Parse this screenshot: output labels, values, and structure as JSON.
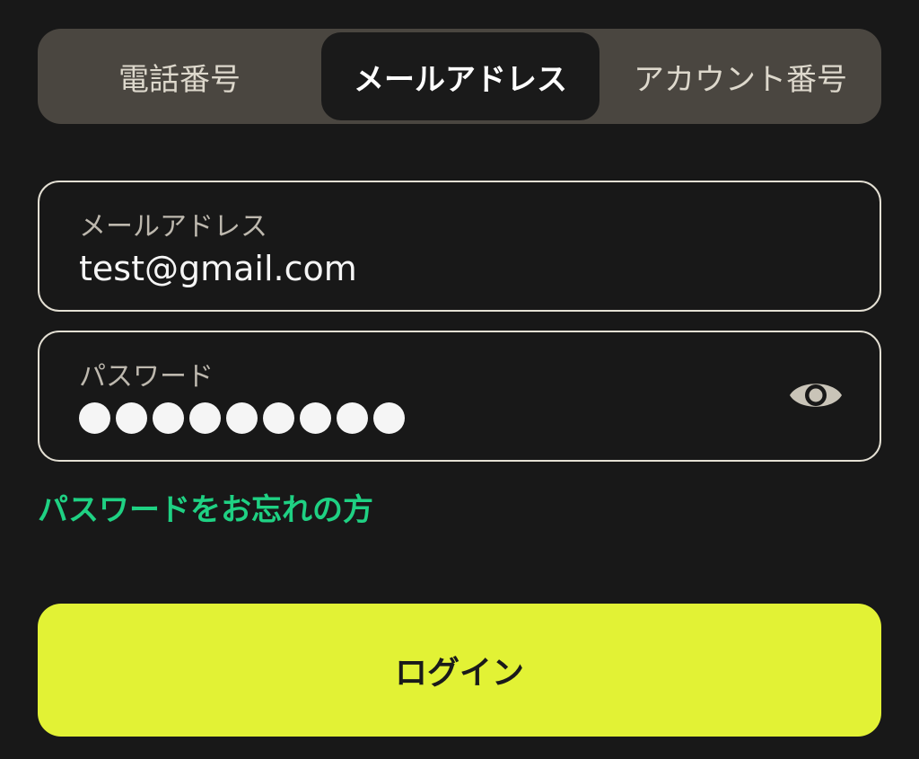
{
  "tabs": {
    "phone": "電話番号",
    "email": "メールアドレス",
    "account": "アカウント番号",
    "selected": "email"
  },
  "email_field": {
    "label": "メールアドレス",
    "value": "test@gmail.com"
  },
  "password_field": {
    "label": "パスワード",
    "masked_length": 9,
    "toggle_icon": "eye-icon"
  },
  "forgot_link": "パスワードをお忘れの方",
  "login_button": "ログイン",
  "colors": {
    "background": "#181818",
    "tab_bar": "#4a4640",
    "accent_green": "#1fd183",
    "button_yellow": "#e2f235"
  }
}
